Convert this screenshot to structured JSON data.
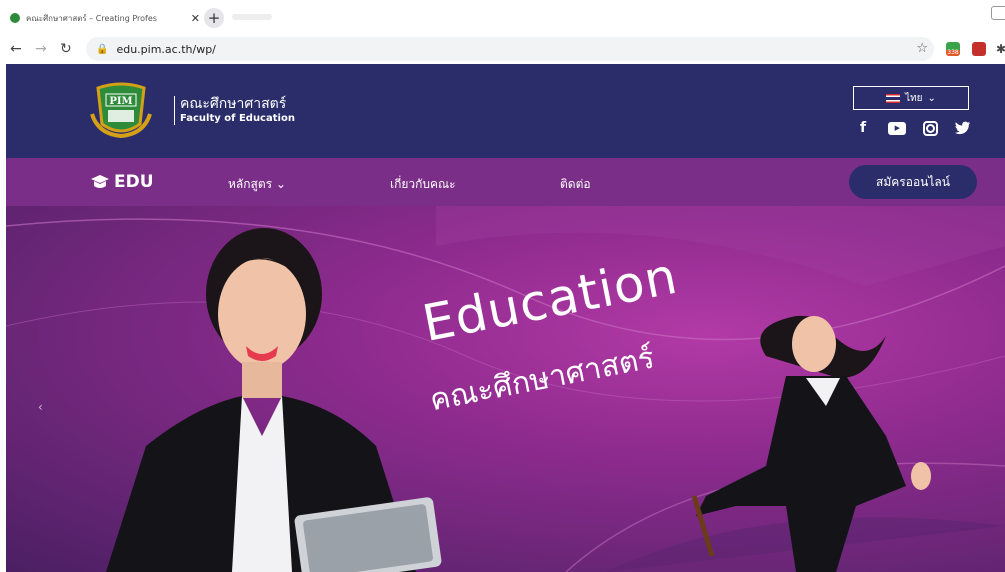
{
  "browser": {
    "tab_title": "คณะศึกษาศาสตร์ – Creating Profes",
    "url": "edu.pim.ac.th/wp/",
    "icons": [
      "back-icon",
      "forward-icon",
      "reload-icon",
      "lock-icon",
      "star-icon"
    ],
    "extension_badge": "338"
  },
  "header": {
    "logo_text": "PIM",
    "brand_th": "คณะศึกษาศาสตร์",
    "brand_en": "Faculty of Education",
    "language": "ไทย",
    "socials": [
      "facebook-icon",
      "youtube-icon",
      "instagram-icon",
      "twitter-icon"
    ],
    "colors": {
      "header_bg": "#2b2d6b",
      "nav_bg": "#7a2e87"
    }
  },
  "nav": {
    "edu_label": "EDU",
    "items": [
      {
        "label": "หลักสูตร ⌄"
      },
      {
        "label": "เกี่ยวกับคณะ"
      },
      {
        "label": "ติดต่อ"
      }
    ],
    "cta_label": "สมัครออนไลน์"
  },
  "hero": {
    "title": "Education",
    "subtitle": "คณะศึกษาศาสตร์"
  }
}
